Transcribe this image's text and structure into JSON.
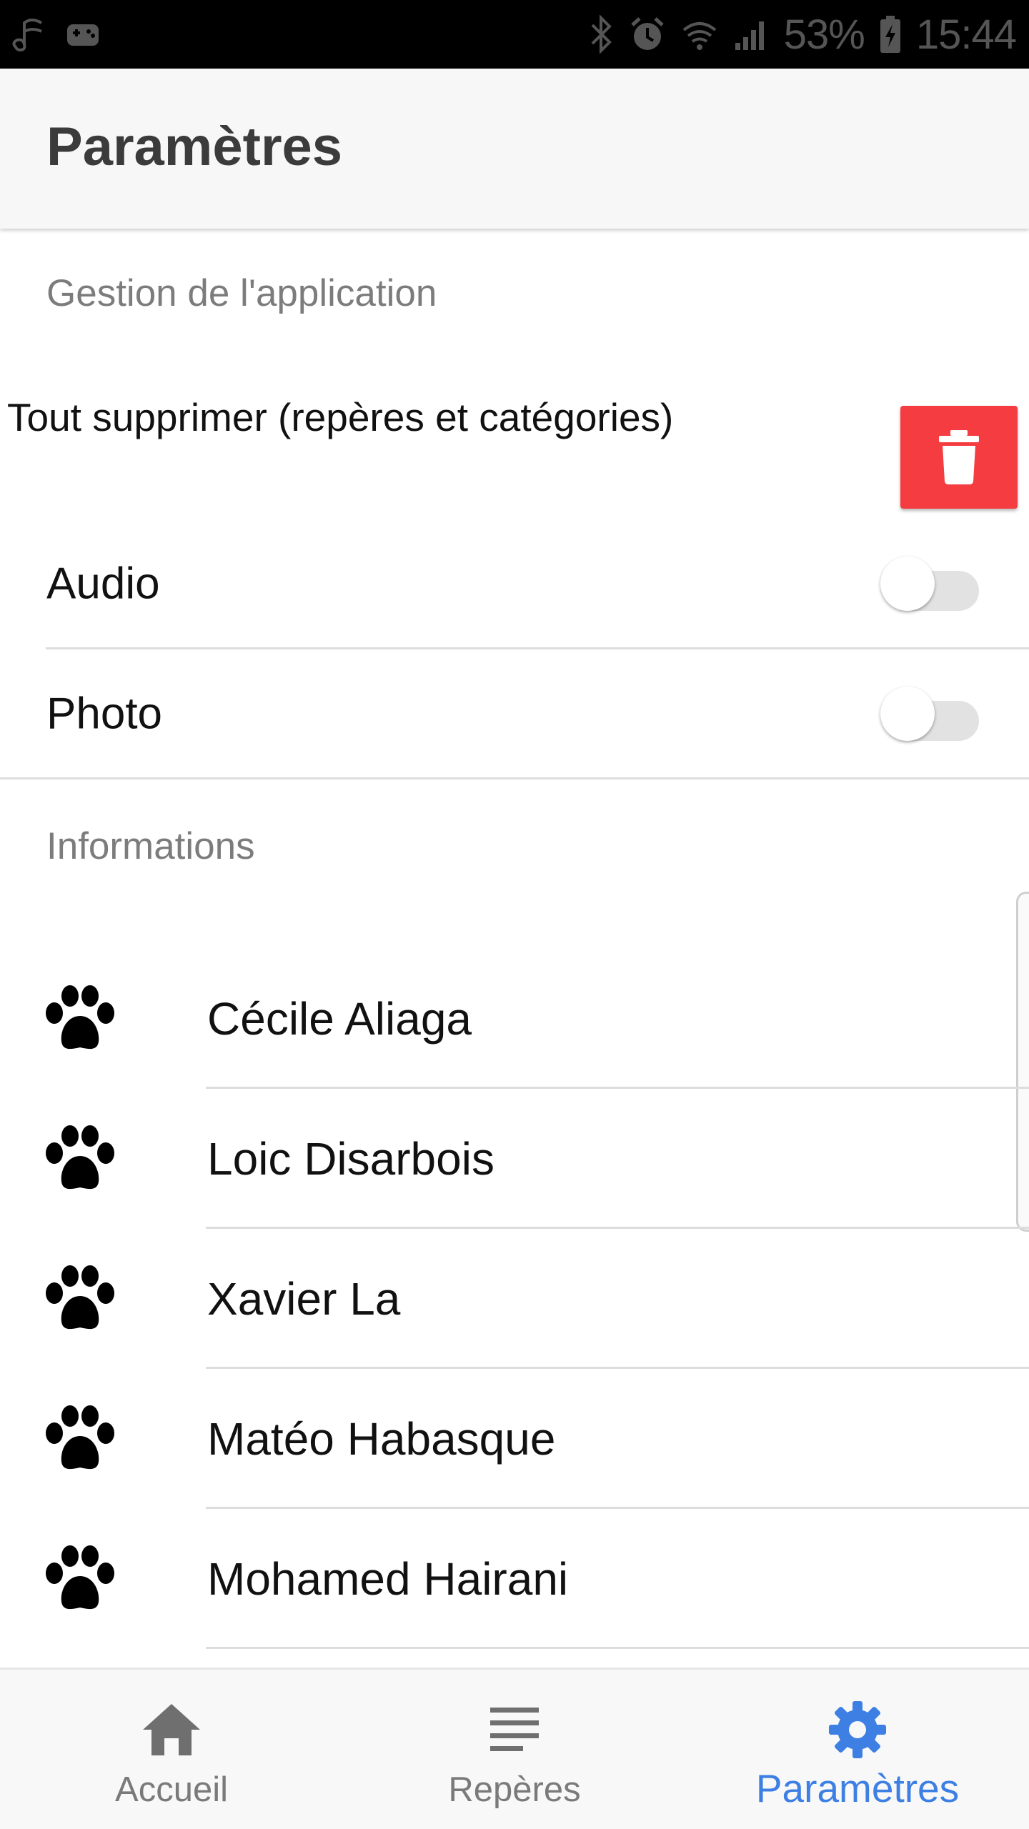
{
  "status_bar": {
    "battery": "53%",
    "time": "15:44"
  },
  "app_bar": {
    "title": "Paramètres"
  },
  "sections": {
    "app_management": "Gestion de l'application",
    "information": "Informations"
  },
  "delete_all": {
    "label": "Tout supprimer (repères et catégories)",
    "icon": "trash-icon"
  },
  "toggles": {
    "audio": {
      "label": "Audio",
      "on": false
    },
    "photo": {
      "label": "Photo",
      "on": false
    }
  },
  "contributors": [
    {
      "name": "Cécile Aliaga",
      "icon": "paw-icon"
    },
    {
      "name": "Loic Disarbois",
      "icon": "paw-icon"
    },
    {
      "name": "Xavier La",
      "icon": "paw-icon"
    },
    {
      "name": "Matéo Habasque",
      "icon": "paw-icon"
    },
    {
      "name": "Mohamed Hairani",
      "icon": "paw-icon"
    }
  ],
  "bottom_nav": {
    "items": [
      {
        "label": "Accueil",
        "icon": "home-icon",
        "active": false
      },
      {
        "label": "Repères",
        "icon": "list-icon",
        "active": false
      },
      {
        "label": "Paramètres",
        "icon": "gear-icon",
        "active": true
      }
    ]
  },
  "colors": {
    "accent": "#3d7fe3",
    "danger": "#f53c41",
    "toggle_track": "#e2e2e2"
  }
}
